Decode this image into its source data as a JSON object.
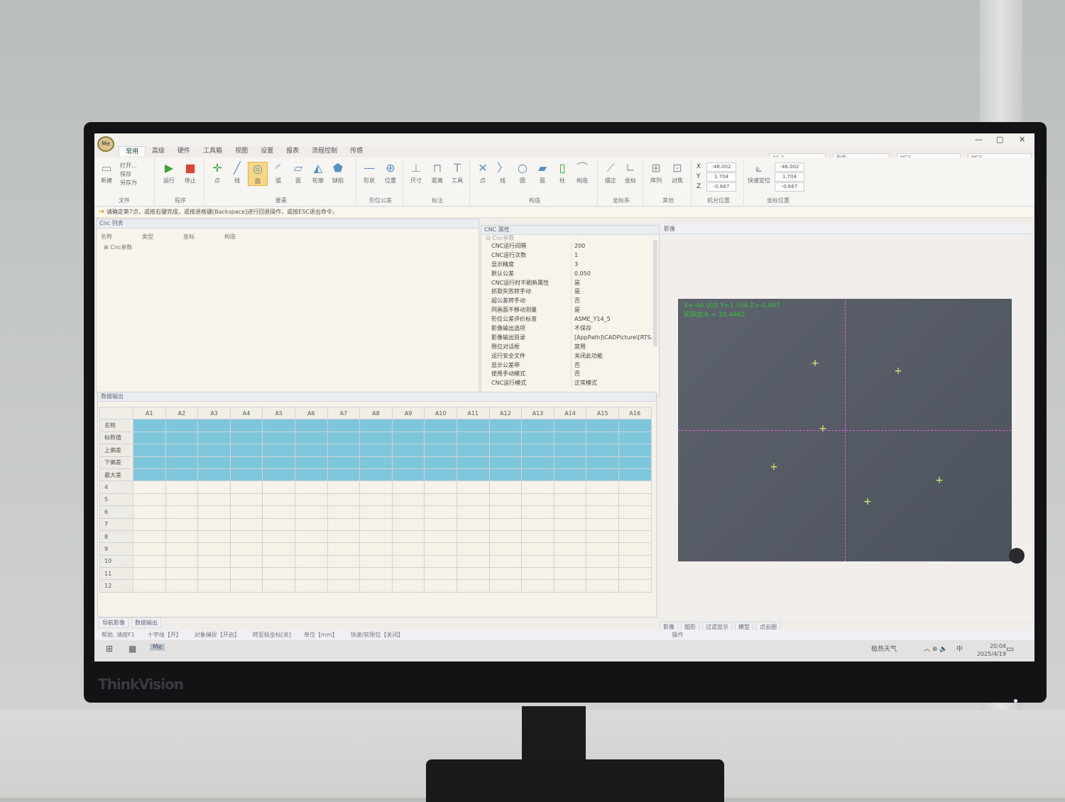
{
  "title_controls": {
    "min": "—",
    "max": "▢",
    "close": "✕"
  },
  "tabs": [
    "常用",
    "高级",
    "硬件",
    "工具箱",
    "视图",
    "设置",
    "报表",
    "流程控制",
    "传感"
  ],
  "ribbon": {
    "file_items": [
      "打开...",
      "保存",
      "另存为"
    ],
    "new_label": "新建",
    "groups": [
      {
        "label": "文件"
      },
      {
        "label": "程序"
      },
      {
        "label": "要素"
      },
      {
        "label": "形位公差"
      },
      {
        "label": "标注"
      },
      {
        "label": "构造"
      },
      {
        "label": "坐标系"
      },
      {
        "label": "其他"
      },
      {
        "label": "机台位置"
      },
      {
        "label": "坐标位置"
      }
    ],
    "program_btns": [
      "运行",
      "停止"
    ],
    "element_btns": [
      "点",
      "线",
      "圆",
      "弧",
      "面",
      "轮廓",
      "缺陷"
    ],
    "tolerance_btns": [
      "形状",
      "位置"
    ],
    "annotation_btns": [
      "尺寸",
      "距离",
      "工具"
    ],
    "construct_btns": [
      "点",
      "线",
      "圆",
      "面",
      "柱",
      "构造"
    ],
    "coord_btns": [
      "摆正",
      "坐标"
    ],
    "other_btns": [
      "阵列",
      "对焦"
    ],
    "machine_pos": {
      "X": "-46.002",
      "Y": "1.704",
      "Z": "-0.667"
    },
    "quick_locate": "快速定位",
    "coord_pos": {
      "X": "-46.002",
      "Y": "1.704",
      "Z": "-0.667"
    },
    "top_combos": [
      "X0.7",
      "影像",
      "MCS",
      "MCS"
    ]
  },
  "command_line": "请确定第7点，或按右键完成，或按退格键[Backspace]进行回退操作，或按ESC退出命令。",
  "cnc_list": {
    "title": "Cnc 列表",
    "columns": [
      "名称",
      "类型",
      "坐标",
      "构造"
    ],
    "items": [
      "Cnc参数"
    ]
  },
  "cnc_props": {
    "title": "CNC 属性",
    "category": "Cnc参数",
    "rows": [
      {
        "k": "CNC运行间隔",
        "v": "200"
      },
      {
        "k": "CNC运行次数",
        "v": "1"
      },
      {
        "k": "显示精度",
        "v": "3"
      },
      {
        "k": "默认公差",
        "v": "0.050"
      },
      {
        "k": "CNC运行时不刷新属性",
        "v": "是"
      },
      {
        "k": "抓取失败转手动",
        "v": "是"
      },
      {
        "k": "超公差转手动",
        "v": "否"
      },
      {
        "k": "同画面不移动测量",
        "v": "是"
      },
      {
        "k": "形位公差评价标准",
        "v": "ASME_Y14_5"
      },
      {
        "k": "影像输出选项",
        "v": "不保存"
      },
      {
        "k": "影像输出目录",
        "v": "[AppPath]\\CADPicture\\[RTS..."
      },
      {
        "k": "限位对话框",
        "v": "禁用"
      },
      {
        "k": "运行安全文件",
        "v": "关闭此功能"
      },
      {
        "k": "显示公差带",
        "v": "否"
      },
      {
        "k": "使用手动模式",
        "v": "否"
      },
      {
        "k": "CNC运行模式",
        "v": "正常模式"
      }
    ]
  },
  "data_output": {
    "title": "数据输出",
    "columns": [
      "A1",
      "A2",
      "A3",
      "A4",
      "A5",
      "A6",
      "A7",
      "A8",
      "A9",
      "A10",
      "A11",
      "A12",
      "A13",
      "A14",
      "A15",
      "A16"
    ],
    "row_labels": [
      "名称",
      "标称值",
      "上偏差",
      "下偏差",
      "最大差",
      "4",
      "5",
      "6",
      "7",
      "8",
      "9",
      "10",
      "11",
      "12"
    ]
  },
  "left_bottom_tabs": [
    "导航影像",
    "数据输出"
  ],
  "image_panel": {
    "title": "影像",
    "info_line1": "X=-46.002 Y=1.704 Z=-0.667",
    "info_line2": "实际放大 = 20.4462",
    "bottom_tabs": [
      "影像",
      "图形",
      "过滤显示",
      "模型",
      "点云图"
    ]
  },
  "help_bar": [
    "帮助, 请按F1",
    "十字线【开】",
    "对象捕捉【开启】",
    "转至极坐标[关]",
    "单位【mm】",
    "快速/软限位【关闭】",
    "操作"
  ],
  "taskbar": {
    "weather": "极热天气",
    "ime": "中",
    "time": "20:04",
    "date": "2025/4/19"
  },
  "monitor_brand": "ThinkVision"
}
